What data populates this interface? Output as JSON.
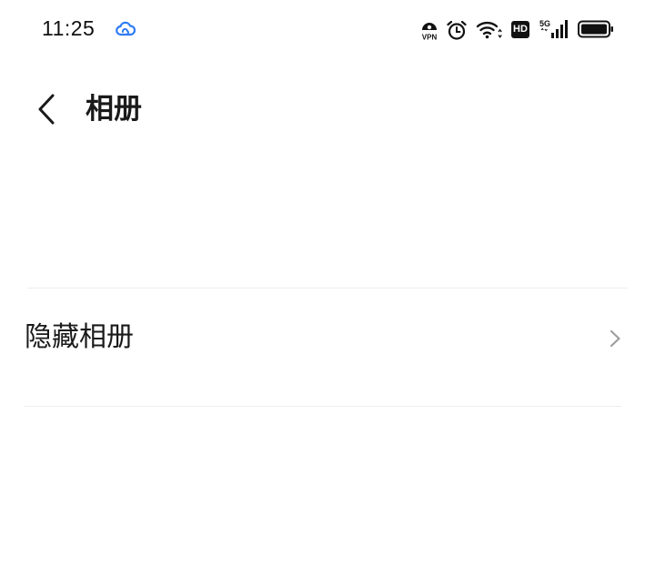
{
  "status_bar": {
    "time": "11:25",
    "vpn_label": "VPN",
    "hd_label": "HD",
    "network_label": "5G",
    "icons": {
      "sync": "cloud-sync-icon",
      "vpn": "vpn-icon",
      "alarm": "alarm-icon",
      "wifi": "wifi-icon",
      "hd": "hd-icon",
      "signal": "signal-5g-icon",
      "battery": "battery-icon"
    }
  },
  "header": {
    "title": "相册",
    "back_icon": "chevron-left-icon"
  },
  "list": {
    "items": [
      {
        "label": "隐藏相册",
        "icon": "chevron-right-icon"
      }
    ]
  },
  "colors": {
    "background": "#ffffff",
    "text": "#1a1a1a",
    "divider": "#eeeeee",
    "chevron": "#9e9e9e",
    "accent": "#2f7cf6"
  }
}
